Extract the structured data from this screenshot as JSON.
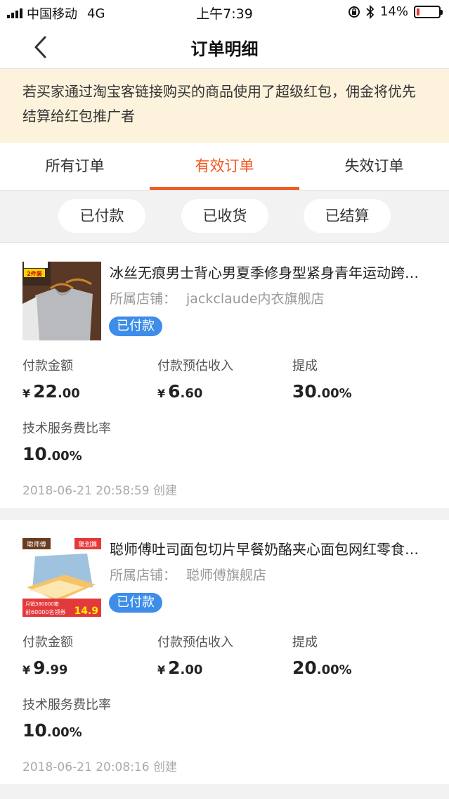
{
  "status_bar": {
    "carrier": "中国移动",
    "network": "4G",
    "time": "上午7:39",
    "battery": "14%",
    "battery_level": 0.14
  },
  "nav": {
    "title": "订单明细"
  },
  "notice": {
    "text": "若买家通过淘宝客链接购买的商品使用了超级红包，佣金将优先结算给红包推广者"
  },
  "tabs": [
    {
      "label": "所有订单",
      "active": false
    },
    {
      "label": "有效订单",
      "active": true
    },
    {
      "label": "失效订单",
      "active": false
    }
  ],
  "filters": [
    "已付款",
    "已收货",
    "已结算"
  ],
  "labels": {
    "store_prefix": "所属店铺：",
    "pay_amount": "付款金额",
    "est_income": "付款预估收入",
    "commission": "提成",
    "service_rate": "技术服务费比率",
    "currency": "¥"
  },
  "orders": [
    {
      "title": "冰丝无痕男士背心男夏季修身型紧身青年运动跨栏背心",
      "store": "jackclaude内衣旗舰店",
      "status": "已付款",
      "pay_int": "22",
      "pay_dec": ".00",
      "income_int": "6",
      "income_dec": ".60",
      "commission_int": "30",
      "commission_dec": ".00%",
      "rate_int": "10",
      "rate_dec": ".00%",
      "created": "2018-06-21 20:58:59 创建",
      "thumb_label": "2件装"
    },
    {
      "title": "聪师傅吐司面包切片早餐奶酪夹心面包网红零食整箱",
      "store": "聪师傅旗舰店",
      "status": "已付款",
      "pay_int": "9",
      "pay_dec": ".99",
      "income_int": "2",
      "income_dec": ".00",
      "commission_int": "20",
      "commission_dec": ".00%",
      "rate_int": "10",
      "rate_dec": ".00%",
      "created": "2018-06-21 20:08:16 创建",
      "thumb_brand": "聪师傅",
      "thumb_tag": "聚划算",
      "thumb_promo": "前60000名领券",
      "thumb_sales": "月销380000箱",
      "thumb_price": "14.9"
    }
  ],
  "colors": {
    "accent": "#f15a22",
    "badge": "#3d8de9",
    "notice_bg": "#fdf3dc"
  }
}
